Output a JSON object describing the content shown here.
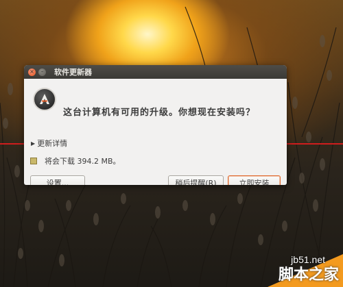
{
  "dialog": {
    "title": "软件更新器",
    "question": "这台计算机有可用的升级。你想现在安装吗？",
    "details_label": "更新详情",
    "download_text": "将会下载 394.2 MB。",
    "buttons": {
      "settings": "设置...",
      "remind_later": "稍后提醒(R)",
      "install_now": "立即安装"
    }
  },
  "watermark": {
    "site": "jb51.net",
    "name": "脚本之家"
  },
  "colors": {
    "titlebar": "#3b3a36",
    "dialog_bg": "#f2f1f0",
    "close_button": "#e05420",
    "install_border": "#e06a2e",
    "annotation_line": "#d01d1d",
    "watermark_orange": "#f39a1f"
  },
  "icons": {
    "close": "close-icon",
    "minimize": "minimize-icon",
    "app": "software-updater-icon",
    "expander": "triangle-right-icon",
    "download": "download-icon"
  }
}
